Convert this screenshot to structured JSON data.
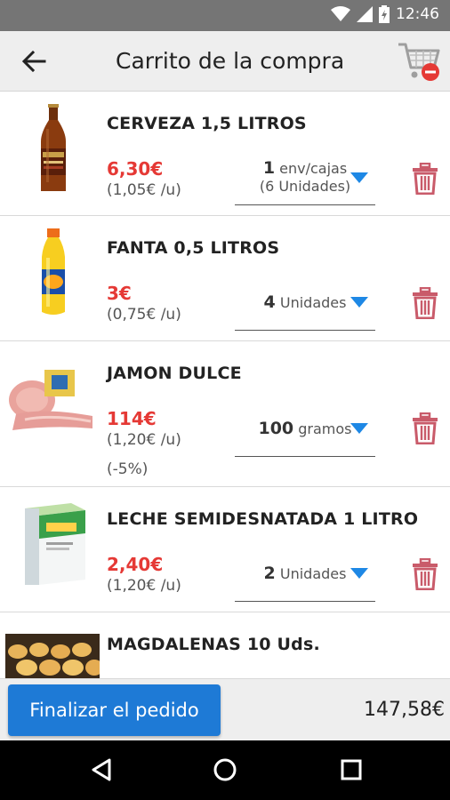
{
  "status_bar": {
    "time": "12:46",
    "icons": [
      "wifi-icon",
      "signal-icon",
      "battery-icon"
    ]
  },
  "toolbar": {
    "title": "Carrito de la compra",
    "back_icon": "arrow-left-icon",
    "cart_icon": "cart-remove-icon"
  },
  "colors": {
    "price": "#e53935",
    "accent": "#1e7ad6",
    "dropdown": "#1e88e5",
    "trash": "#c95b6a"
  },
  "items": [
    {
      "name": "CERVEZA 1,5 LITROS",
      "price": "6,30€",
      "unit_price": "(1,05€ /u)",
      "qty_num": "1",
      "qty_unit": "env/cajas",
      "qty_detail": "(6 Unidades)",
      "discount": "",
      "image": "beer-bottle"
    },
    {
      "name": "FANTA 0,5 LITROS",
      "price": "3€",
      "unit_price": "(0,75€ /u)",
      "qty_num": "4",
      "qty_unit": "Unidades",
      "qty_detail": "",
      "discount": "",
      "image": "soda-bottle"
    },
    {
      "name": "JAMON DULCE",
      "price": "114€",
      "unit_price": "(1,20€ /u)",
      "qty_num": "100",
      "qty_unit": "gramos",
      "qty_detail": "",
      "discount": "(-5%)",
      "image": "ham"
    },
    {
      "name": "LECHE SEMIDESNATADA 1 LITRO",
      "price": "2,40€",
      "unit_price": "(1,20€ /u)",
      "qty_num": "2",
      "qty_unit": "Unidades",
      "qty_detail": "",
      "discount": "",
      "image": "milk-carton"
    },
    {
      "name": "MAGDALENAS 10 Uds.",
      "image": "muffins"
    }
  ],
  "footer": {
    "finalize_label": "Finalizar el pedido",
    "total": "147,58€"
  },
  "nav": {
    "icons": [
      "back-triangle-icon",
      "home-circle-icon",
      "recents-square-icon"
    ]
  }
}
